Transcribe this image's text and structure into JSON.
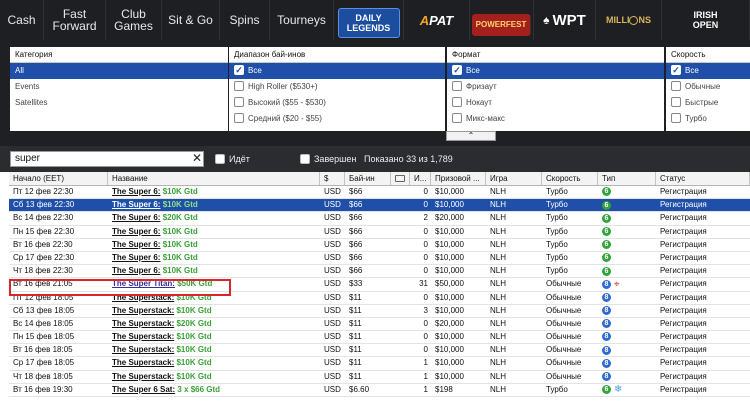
{
  "nav": {
    "tabs": [
      {
        "label": "Cash"
      },
      {
        "label": "Fast Forward"
      },
      {
        "label": "Club Games"
      },
      {
        "label": "Sit & Go"
      },
      {
        "label": "Spins"
      },
      {
        "label": "Tourneys"
      }
    ],
    "promos": {
      "daily_legends_1": "DAILY",
      "daily_legends_2": "LEGENDS",
      "apat_a": "A",
      "apat_rest": "PAT",
      "powerfest": "POWERFEST",
      "wpt": "WPT",
      "millions": "MILLI",
      "millions_suffix": "NS",
      "irish_1": "IRISH",
      "irish_2": "OPEN"
    }
  },
  "filters": {
    "category": {
      "header": "Категория",
      "items": [
        "All",
        "Events",
        "Satellites"
      ]
    },
    "buyin": {
      "header": "Диапазон бай-инов",
      "items": [
        "Все",
        "High Roller ($530+)",
        "Высокий ($55 - $530)",
        "Средний ($20 - $55)"
      ]
    },
    "format": {
      "header": "Формат",
      "items": [
        "Все",
        "Фризаут",
        "Нокаут",
        "Микс-макс"
      ]
    },
    "speed": {
      "header": "Скорость",
      "items": [
        "Все",
        "Обычные",
        "Быстрые",
        "Турбо"
      ]
    }
  },
  "search": {
    "value": "super",
    "running_label": "Идёт",
    "finished_label": "Завершен",
    "shown_text": "Показано 33 из 1,789"
  },
  "table": {
    "headers": [
      "Начало (EET)",
      "Название",
      "$",
      "Бай-ин",
      "",
      "И...",
      "Призовой ...",
      "Игра",
      "Скорость",
      "Тип",
      "Статус"
    ],
    "rows": [
      {
        "start": "Пт 12 фев 22:30",
        "name_a": "The Super 6:",
        "name_b": "$10K Gtd",
        "cur": "USD",
        "buyin": "$66",
        "entrants": "0",
        "prize": "$10,000",
        "game": "NLH",
        "speed": "Турбо",
        "type_num": "6",
        "status": "Регистрация"
      },
      {
        "start": "Сб 13 фев 22:30",
        "name_a": "The Super 6:",
        "name_b": "$10K Gtd",
        "cur": "USD",
        "buyin": "$66",
        "entrants": "0",
        "prize": "$10,000",
        "game": "NLH",
        "speed": "Турбо",
        "type_num": "6",
        "status": "Регистрация"
      },
      {
        "start": "Вс 14 фев 22:30",
        "name_a": "The Super 6:",
        "name_b": "$20K Gtd",
        "cur": "USD",
        "buyin": "$66",
        "entrants": "2",
        "prize": "$20,000",
        "game": "NLH",
        "speed": "Турбо",
        "type_num": "6",
        "status": "Регистрация"
      },
      {
        "start": "Пн 15 фев 22:30",
        "name_a": "The Super 6:",
        "name_b": "$10K Gtd",
        "cur": "USD",
        "buyin": "$66",
        "entrants": "0",
        "prize": "$10,000",
        "game": "NLH",
        "speed": "Турбо",
        "type_num": "6",
        "status": "Регистрация"
      },
      {
        "start": "Вт 16 фев 22:30",
        "name_a": "The Super 6:",
        "name_b": "$10K Gtd",
        "cur": "USD",
        "buyin": "$66",
        "entrants": "0",
        "prize": "$10,000",
        "game": "NLH",
        "speed": "Турбо",
        "type_num": "6",
        "status": "Регистрация"
      },
      {
        "start": "Ср 17 фев 22:30",
        "name_a": "The Super 6:",
        "name_b": "$10K Gtd",
        "cur": "USD",
        "buyin": "$66",
        "entrants": "0",
        "prize": "$10,000",
        "game": "NLH",
        "speed": "Турбо",
        "type_num": "6",
        "status": "Регистрация"
      },
      {
        "start": "Чт 18 фев 22:30",
        "name_a": "The Super 6:",
        "name_b": "$10K Gtd",
        "cur": "USD",
        "buyin": "$66",
        "entrants": "0",
        "prize": "$10,000",
        "game": "NLH",
        "speed": "Турбо",
        "type_num": "6",
        "status": "Регистрация"
      },
      {
        "start": "Вт 16 фев 21:05",
        "name_a": "The Super Titan:",
        "name_b": "$50K Gtd",
        "cur": "USD",
        "buyin": "$33",
        "entrants": "31",
        "prize": "$50,000",
        "game": "NLH",
        "speed": "Обычные",
        "type_num": "8",
        "status": "Регистрация"
      },
      {
        "start": "Пт 12 фев 18:05",
        "name_a": "The Superstack:",
        "name_b": "$10K Gtd",
        "cur": "USD",
        "buyin": "$11",
        "entrants": "0",
        "prize": "$10,000",
        "game": "NLH",
        "speed": "Обычные",
        "type_num": "8",
        "status": "Регистрация"
      },
      {
        "start": "Сб 13 фев 18:05",
        "name_a": "The Superstack:",
        "name_b": "$10K Gtd",
        "cur": "USD",
        "buyin": "$11",
        "entrants": "3",
        "prize": "$10,000",
        "game": "NLH",
        "speed": "Обычные",
        "type_num": "8",
        "status": "Регистрация"
      },
      {
        "start": "Вс 14 фев 18:05",
        "name_a": "The Superstack:",
        "name_b": "$20K Gtd",
        "cur": "USD",
        "buyin": "$11",
        "entrants": "0",
        "prize": "$20,000",
        "game": "NLH",
        "speed": "Обычные",
        "type_num": "8",
        "status": "Регистрация"
      },
      {
        "start": "Пн 15 фев 18:05",
        "name_a": "The Superstack:",
        "name_b": "$10K Gtd",
        "cur": "USD",
        "buyin": "$11",
        "entrants": "0",
        "prize": "$10,000",
        "game": "NLH",
        "speed": "Обычные",
        "type_num": "8",
        "status": "Регистрация"
      },
      {
        "start": "Вт 16 фев 18:05",
        "name_a": "The Superstack:",
        "name_b": "$10K Gtd",
        "cur": "USD",
        "buyin": "$11",
        "entrants": "0",
        "prize": "$10,000",
        "game": "NLH",
        "speed": "Обычные",
        "type_num": "8",
        "status": "Регистрация"
      },
      {
        "start": "Ср 17 фев 18:05",
        "name_a": "The Superstack:",
        "name_b": "$10K Gtd",
        "cur": "USD",
        "buyin": "$11",
        "entrants": "1",
        "prize": "$10,000",
        "game": "NLH",
        "speed": "Обычные",
        "type_num": "8",
        "status": "Регистрация"
      },
      {
        "start": "Чт 18 фев 18:05",
        "name_a": "The Superstack:",
        "name_b": "$10K Gtd",
        "cur": "USD",
        "buyin": "$11",
        "entrants": "1",
        "prize": "$10,000",
        "game": "NLH",
        "speed": "Обычные",
        "type_num": "8",
        "status": "Регистрация"
      },
      {
        "start": "Вт 16 фев 19:30",
        "name_a": "The Super 6 Sat:",
        "name_b": "3 x $66 Gtd",
        "cur": "USD",
        "buyin": "$6.60",
        "entrants": "1",
        "prize": "$198",
        "game": "NLH",
        "speed": "Турбо",
        "type_num": "6",
        "status": "Регистрация"
      }
    ]
  },
  "colors": {
    "nav_bg": "#1d1f22",
    "selection_blue": "#1f4fa8",
    "gtd_green": "#3aa238",
    "turbo_badge": "#31a43a",
    "regular_badge": "#2e6ad0",
    "highlight_red": "#d8262a"
  }
}
